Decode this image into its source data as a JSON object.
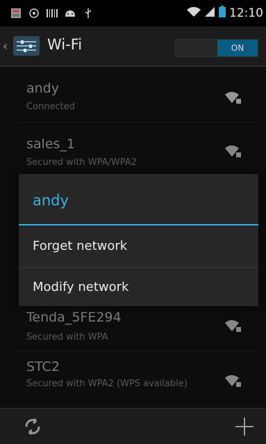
{
  "status_bar": {
    "time": "12:10",
    "icons": [
      "app-icon",
      "wifi-settings-icon",
      "barcode-icon",
      "android-icon",
      "usb-icon"
    ]
  },
  "action_bar": {
    "title": "Wi-Fi",
    "toggle_label": "ON",
    "toggle_state": "on",
    "accent": "#33b5e5"
  },
  "networks": [
    {
      "name": "andy",
      "status": "Connected"
    },
    {
      "name": "sales_1",
      "status": "Secured with WPA/WPA2"
    },
    {
      "name": "Tenda_5FE294",
      "status": "Secured with WPA"
    },
    {
      "name": "STC2",
      "status": "Secured with WPA2 (WPS available)"
    }
  ],
  "dialog": {
    "title": "andy",
    "items": [
      "Forget network",
      "Modify network"
    ]
  },
  "bottom_bar": {
    "icons": [
      "refresh-icon",
      "add-network-icon"
    ]
  }
}
